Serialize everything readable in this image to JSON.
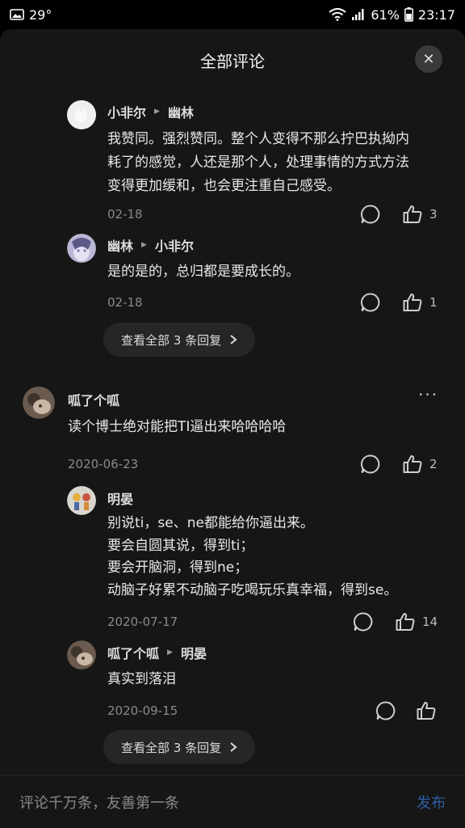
{
  "status_bar": {
    "temperature": "29°",
    "battery": "61%",
    "time": "23:17"
  },
  "header": {
    "title": "全部评论",
    "close_label": "✕"
  },
  "replies_group_1": [
    {
      "author": "小非尔",
      "reply_to": "幽林",
      "text_lines": [
        "我赞同。强烈赞同。整个人变得不那么拧巴执拗内",
        "耗了的感觉，人还是那个人，处理事情的方式方法",
        "变得更加缓和，也会更注重自己感受。"
      ],
      "date": "02-18",
      "likes": "3"
    },
    {
      "author": "幽林",
      "reply_to": "小非尔",
      "text_lines": [
        "是的是的，总归都是要成长的。"
      ],
      "date": "02-18",
      "likes": "1"
    }
  ],
  "view_all_1": "查看全部 3 条回复",
  "comment": {
    "author": "呱了个呱",
    "text_lines": [
      "读个博士绝对能把TI逼出来哈哈哈哈"
    ],
    "date": "2020-06-23",
    "likes": "2",
    "more_label": "···"
  },
  "replies_group_2": [
    {
      "author": "明晏",
      "text_lines": [
        "别说ti，se、ne都能给你逼出来。",
        "要会自圆其说，得到ti；",
        "要会开脑洞，得到ne；",
        "动脑子好累不动脑子吃喝玩乐真幸福，得到se。"
      ],
      "date": "2020-07-17",
      "likes": "14"
    },
    {
      "author": "呱了个呱",
      "reply_to": "明晏",
      "text_lines": [
        "真实到落泪"
      ],
      "date": "2020-09-15",
      "likes": ""
    }
  ],
  "view_all_2": "查看全部 3 条回复",
  "bottom_bar": {
    "placeholder": "评论千万条，友善第一条",
    "publish_label": "发布"
  },
  "colors": {
    "background": "#161616",
    "accent_publish": "#2e5fa8"
  }
}
